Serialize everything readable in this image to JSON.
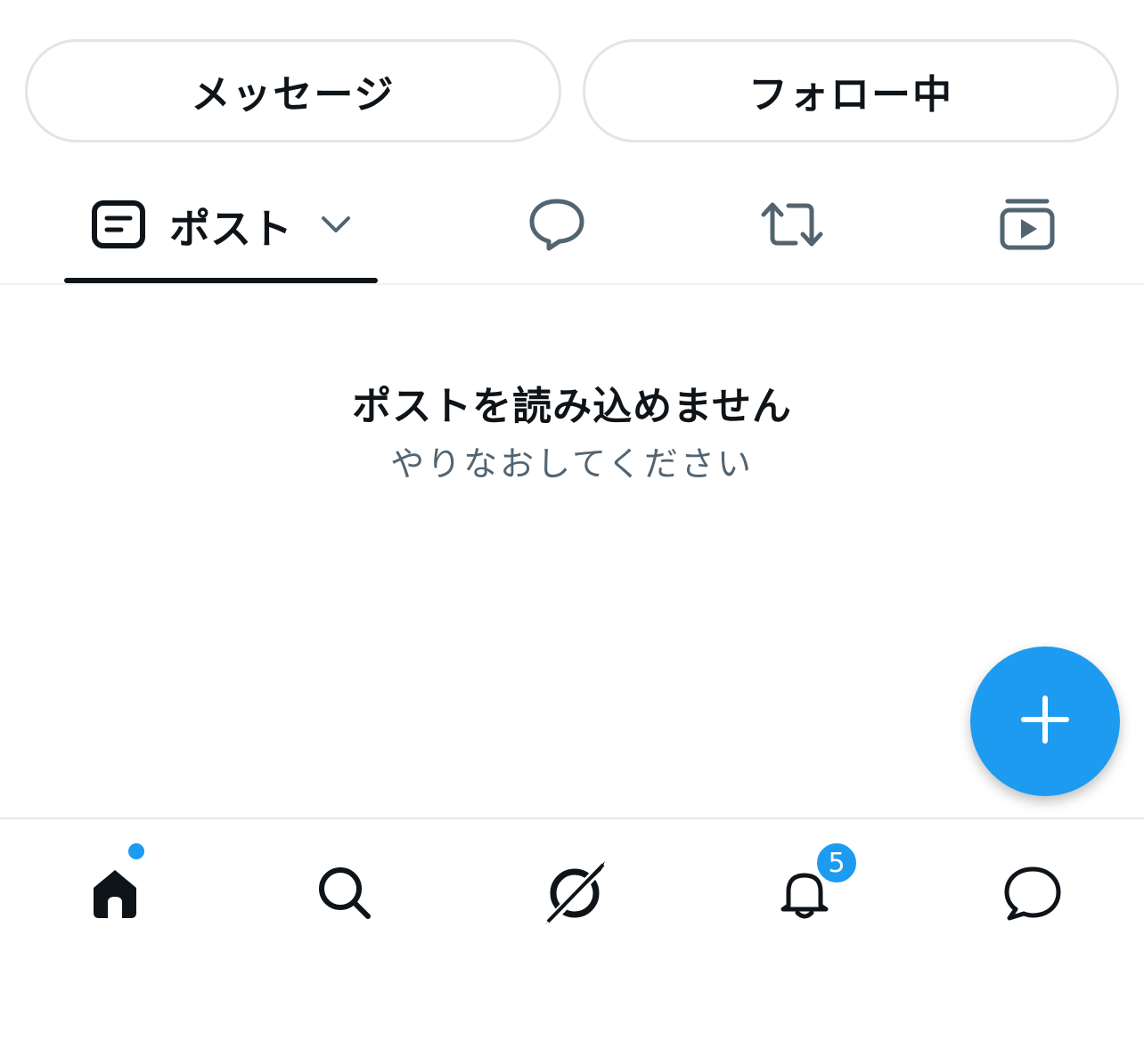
{
  "actions": {
    "message_label": "メッセージ",
    "following_label": "フォロー中"
  },
  "tabs": {
    "posts_label": "ポスト",
    "posts_icon": "post-icon",
    "replies_icon": "reply-bubble-icon",
    "reposts_icon": "repost-icon",
    "media_icon": "media-play-icon"
  },
  "empty_state": {
    "title": "ポストを読み込めません",
    "subtitle": "やりなおしてください"
  },
  "fab": {
    "icon": "plus-icon"
  },
  "bottom_nav": {
    "items": [
      "home-icon",
      "search-icon",
      "grok-icon",
      "bell-icon",
      "messages-icon"
    ],
    "notifications_badge": "5"
  },
  "colors": {
    "accent": "#1d9bf0",
    "text": "#0f1419",
    "secondary_text": "#536471",
    "border": "#e1e4e8"
  }
}
